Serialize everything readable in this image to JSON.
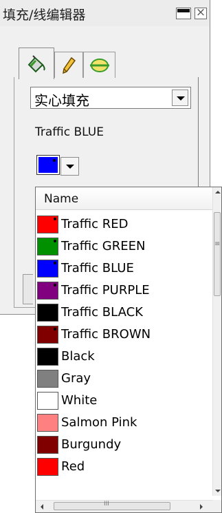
{
  "window": {
    "title": "填充/线编辑器"
  },
  "tabs": [
    {
      "name": "fill",
      "icon": "paint-bucket-icon"
    },
    {
      "name": "pen",
      "icon": "pencil-icon"
    },
    {
      "name": "line",
      "icon": "line-style-icon"
    }
  ],
  "fill_type": {
    "selected": "实心填充"
  },
  "current_color": {
    "name": "Traffic BLUE",
    "hex": "#0000ff"
  },
  "color_list": {
    "header": "Name",
    "items": [
      {
        "label": "Traffic RED",
        "color": "#ff0000",
        "marker": true
      },
      {
        "label": "Traffic GREEN",
        "color": "#009000",
        "marker": true
      },
      {
        "label": "Traffic BLUE",
        "color": "#0000ff",
        "marker": true
      },
      {
        "label": "Traffic PURPLE",
        "color": "#800080",
        "marker": true
      },
      {
        "label": "Traffic BLACK",
        "color": "#000000",
        "marker": true
      },
      {
        "label": "Traffic BROWN",
        "color": "#800000",
        "marker": true
      },
      {
        "label": "Black",
        "color": "#000000",
        "marker": false
      },
      {
        "label": "Gray",
        "color": "#808080",
        "marker": false
      },
      {
        "label": "White",
        "color": "#ffffff",
        "marker": false
      },
      {
        "label": "Salmon Pink",
        "color": "#ff8080",
        "marker": false
      },
      {
        "label": "Burgundy",
        "color": "#800000",
        "marker": false
      },
      {
        "label": "Red",
        "color": "#ff0000",
        "marker": false
      }
    ]
  }
}
